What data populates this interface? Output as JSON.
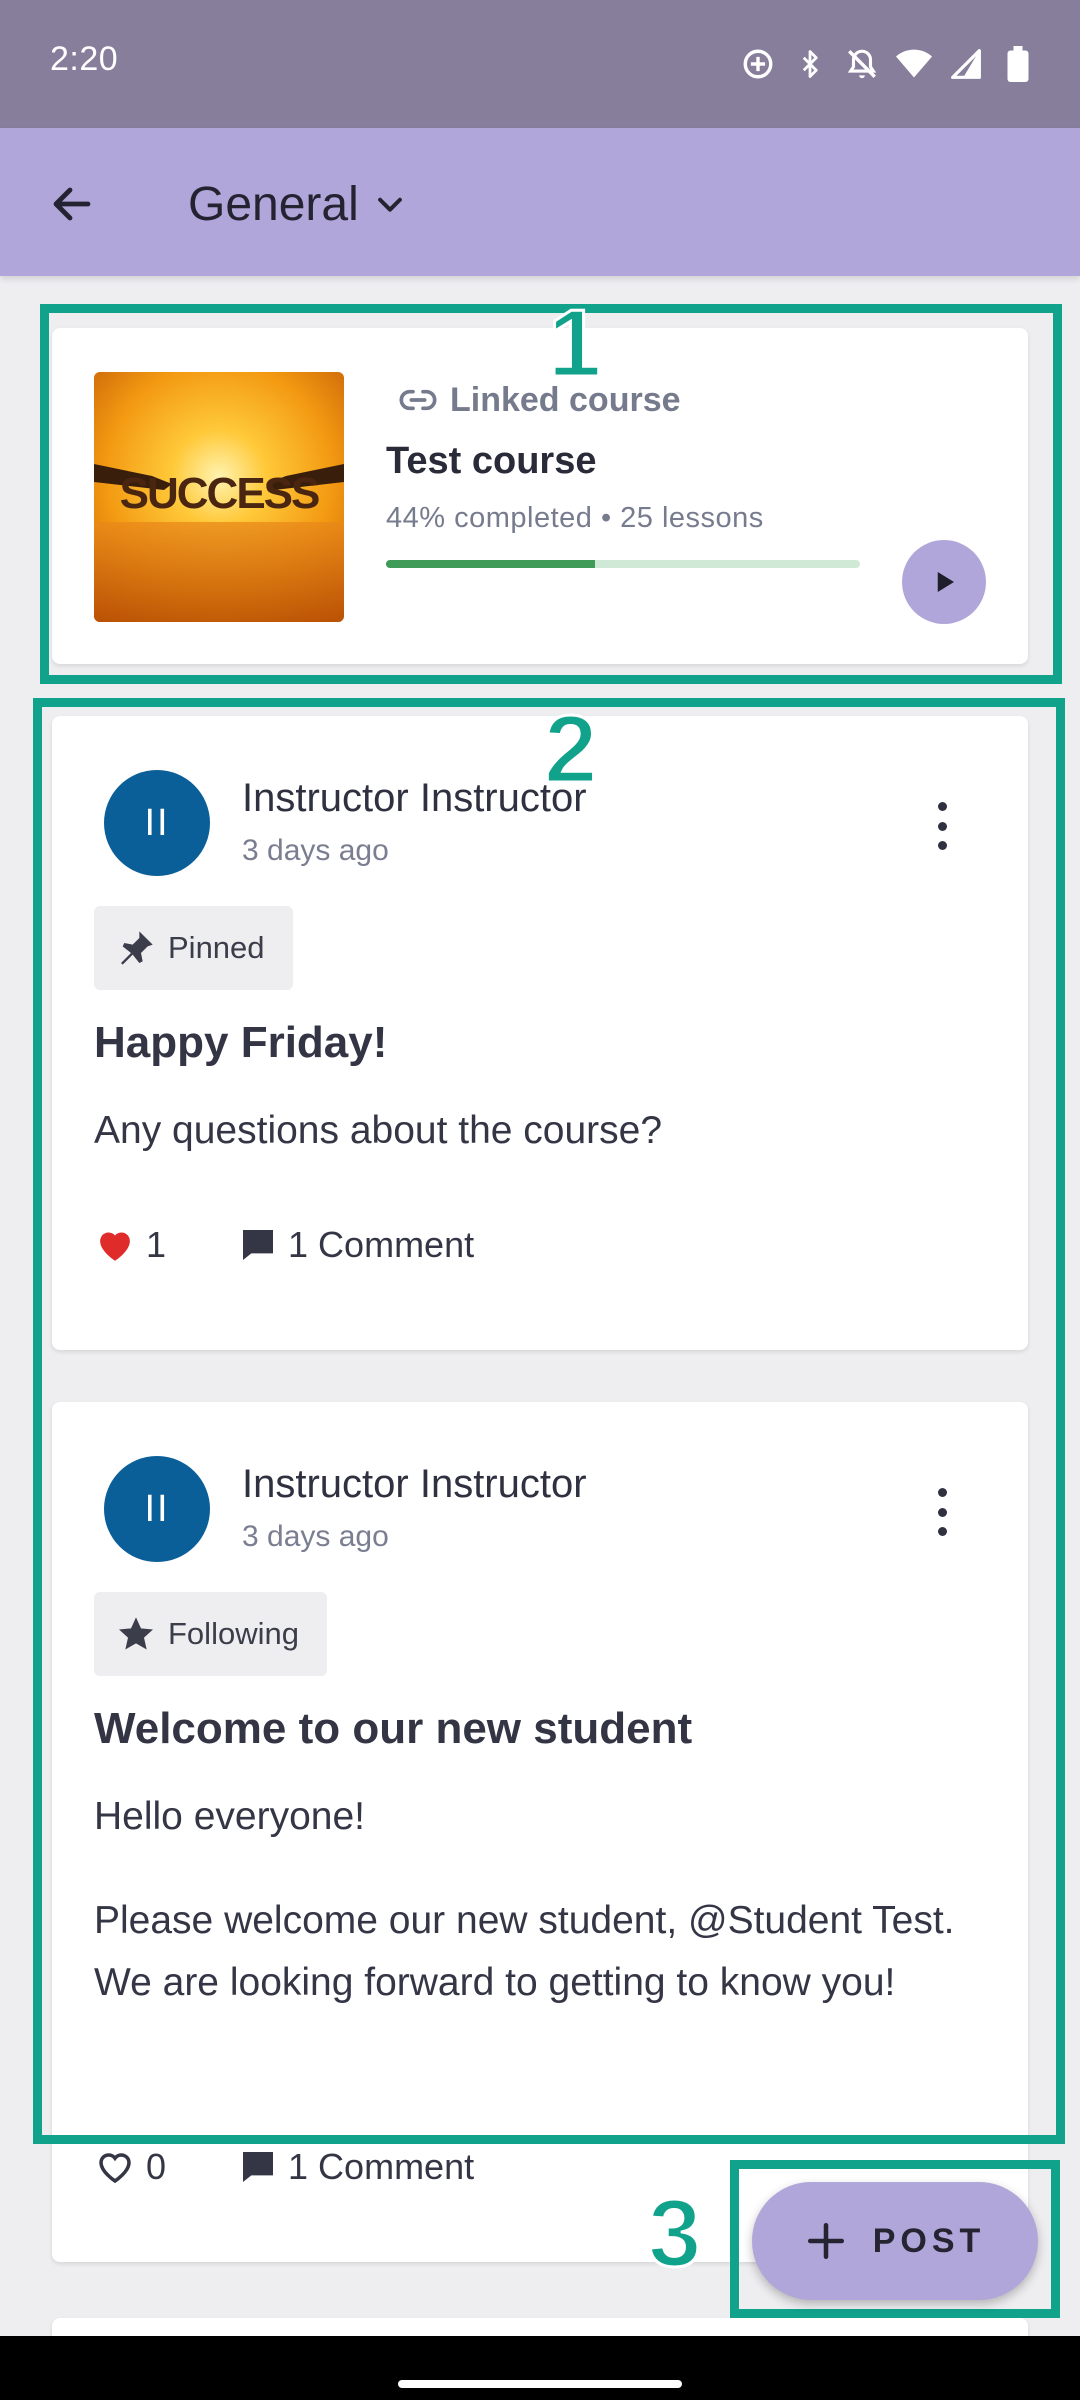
{
  "status_bar": {
    "time": "2:20"
  },
  "app_bar": {
    "title": "General"
  },
  "linked_course": {
    "label": "Linked course",
    "thumbnail_text": "SUCCESS",
    "title": "Test course",
    "meta": "44% completed • 25 lessons",
    "progress": 0.44
  },
  "posts": [
    {
      "avatar_initials": "II",
      "author": "Instructor Instructor",
      "time": "3 days ago",
      "tag": "Pinned",
      "title": "Happy Friday!",
      "body": [
        "Any questions about the course?"
      ],
      "likes": "1",
      "comments": "1 Comment"
    },
    {
      "avatar_initials": "II",
      "author": "Instructor Instructor",
      "time": "3 days ago",
      "tag": "Following",
      "title": "Welcome to our new student",
      "body": [
        "Hello everyone!",
        "Please welcome our new student, @Student Test. We are looking forward to getting to know you!"
      ],
      "likes": "0",
      "comments": "1 Comment"
    }
  ],
  "fab": {
    "label": "POST"
  },
  "annotations": [
    "1",
    "2",
    "3"
  ],
  "colors": {
    "accent": "#b1a6da",
    "status_bar": "#877e9c",
    "annotation": "#11a28c",
    "avatar": "#0b5f99",
    "progress": "#3f9b57",
    "heart": "#e02b2b"
  }
}
